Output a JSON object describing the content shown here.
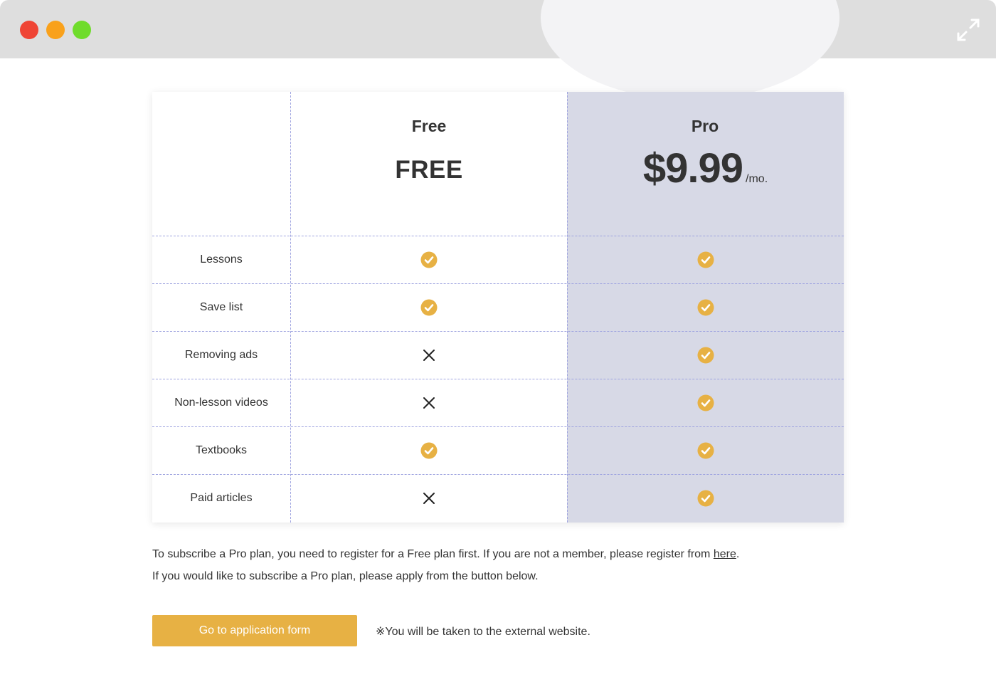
{
  "window": {
    "controls": [
      "close",
      "minimize",
      "maximize"
    ],
    "expand_icon": "expand-arrows-icon"
  },
  "plans": {
    "free": {
      "name": "Free",
      "price": "FREE"
    },
    "pro": {
      "name": "Pro",
      "price": "$9.99",
      "period": "/mo."
    }
  },
  "features": [
    {
      "label": "Lessons",
      "free": "check",
      "pro": "check"
    },
    {
      "label": "Save list",
      "free": "check",
      "pro": "check"
    },
    {
      "label": "Removing ads",
      "free": "cross",
      "pro": "check"
    },
    {
      "label": "Non-lesson videos",
      "free": "cross",
      "pro": "check"
    },
    {
      "label": "Textbooks",
      "free": "check",
      "pro": "check"
    },
    {
      "label": "Paid articles",
      "free": "cross",
      "pro": "check"
    }
  ],
  "notes": {
    "line1_before": "To subscribe a Pro plan, you need to register for a Free plan first. If you are not a member, please register from ",
    "line1_link": "here",
    "line1_after": ".",
    "line2": "If you would like to subscribe a Pro plan, please apply from the button below."
  },
  "cta": {
    "label": "Go to application form",
    "external_note": "※You will be taken to the external website."
  },
  "colors": {
    "accent": "#e7b144",
    "pro_column": "#d7d9e6",
    "divider": "#9fa4e0",
    "titlebar": "#dedede"
  }
}
